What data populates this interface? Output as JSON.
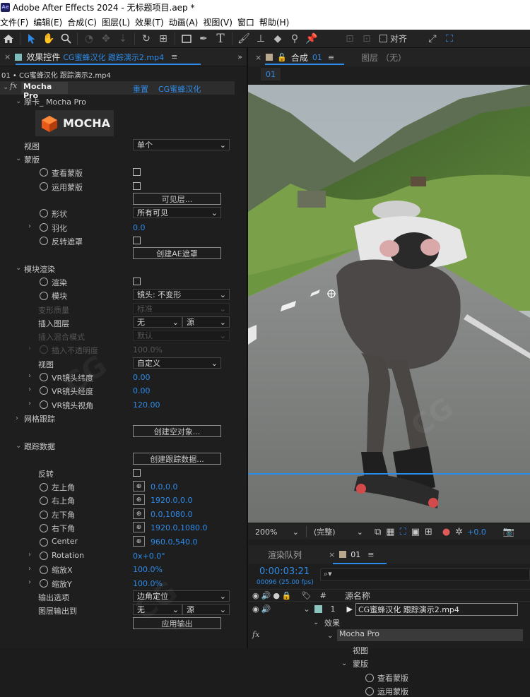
{
  "window": {
    "title": "Adobe After Effects 2024 - 无标题项目.aep *",
    "app_icon": "Ae"
  },
  "menu": [
    "文件(F)",
    "编辑(E)",
    "合成(C)",
    "图层(L)",
    "效果(T)",
    "动画(A)",
    "视图(V)",
    "窗口",
    "帮助(H)"
  ],
  "toolbar": {
    "align_label": "对齐"
  },
  "effects_panel": {
    "title": "效果控件",
    "layer_ref": "CG蜜蜂汉化 跟踪演示2.mp4",
    "breadcrumb": "01 • CG蜜蜂汉化 跟踪演示2.mp4",
    "effect_name": "Mocha Pro",
    "reset_label": "重置",
    "brand_link": "CG蜜蜂汉化",
    "mocha_group": "摩卡_ Mocha Pro",
    "mocha_logo": "MOCHA",
    "view": {
      "label": "视图",
      "value": "单个"
    },
    "matte": {
      "group": "蒙版",
      "view_matte": "查看蒙版",
      "apply_matte": "运用蒙版",
      "visible_layers_btn": "可见层...",
      "shape": {
        "label": "形状",
        "value": "所有可见"
      },
      "feather": {
        "label": "羽化",
        "value": "0.0"
      },
      "invert": "反转遮罩",
      "create_ae_mask_btn": "创建AE遮罩"
    },
    "module_render": {
      "group": "模块渲染",
      "render": "渲染",
      "module": {
        "label": "模块",
        "value": "镜头: 不变形"
      },
      "warp_quality": {
        "label": "变形质量",
        "value": "标准"
      },
      "insert_layer": {
        "label": "插入图层",
        "value": "无",
        "source": "源"
      },
      "insert_blend": {
        "label": "插入混合模式",
        "value": "默认"
      },
      "insert_opacity": {
        "label": "插入不透明度",
        "value": "100.0%"
      },
      "view": {
        "label": "视图",
        "value": "自定义"
      },
      "vr_lat": {
        "label": "VR镜头纬度",
        "value": "0.00"
      },
      "vr_lon": {
        "label": "VR镜头经度",
        "value": "0.00"
      },
      "vr_fov": {
        "label": "VR镜头视角",
        "value": "120.00"
      }
    },
    "mesh_tracking": {
      "group": "网格跟踪",
      "create_null_btn": "创建空对象..."
    },
    "tracking_data": {
      "group": "跟踪数据",
      "create_btn": "创建跟踪数据...",
      "invert": "反转",
      "top_left": {
        "label": "左上角",
        "value": "0.0,0.0"
      },
      "top_right": {
        "label": "右上角",
        "value": "1920.0,0.0"
      },
      "bottom_left": {
        "label": "左下角",
        "value": "0.0,1080.0"
      },
      "bottom_right": {
        "label": "右下角",
        "value": "1920.0,1080.0"
      },
      "center": {
        "label": "Center",
        "value": "960.0,540.0"
      },
      "rotation": {
        "label": "Rotation",
        "value": "0x+0.0°"
      },
      "scale_x": {
        "label": "缩放X",
        "value": "100.0%"
      },
      "scale_y": {
        "label": "缩放Y",
        "value": "100.0%"
      },
      "output_option": {
        "label": "输出选项",
        "value": "边角定位"
      },
      "layer_output": {
        "label": "图层输出到",
        "value": "无",
        "source": "源"
      },
      "apply_btn": "应用输出"
    }
  },
  "comp_panel": {
    "tab_label": "合成",
    "comp_name": "01",
    "layer_tab": "图层 （无）",
    "subtab": "01",
    "zoom": "200%",
    "quality": "(完整)",
    "exposure": "+0.0"
  },
  "timeline": {
    "render_queue_tab": "渲染队列",
    "comp_tab": "01",
    "timecode": "0:00:03:21",
    "frame_info": "00096 (25.00 fps)",
    "col_num": "#",
    "col_source": "源名称",
    "layer_num": "1",
    "layer_name": "CG蜜蜂汉化 跟踪演示2.mp4",
    "effects_label": "效果",
    "effect": "Mocha Pro",
    "view": "视图",
    "matte": "蒙版",
    "view_matte": "查看蒙版",
    "apply_matte": "运用蒙版"
  }
}
